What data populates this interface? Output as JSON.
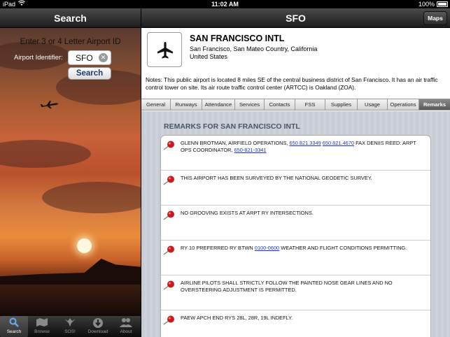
{
  "status": {
    "carrier": "iPad",
    "time": "11:02 AM",
    "battery": "100%"
  },
  "left": {
    "title": "Search",
    "prompt": "Enter 3 or 4 Letter Airport ID",
    "id_label": "Airport Identifier:",
    "id_value": "SFO",
    "search_label": "Search"
  },
  "tabs": [
    {
      "label": "Search",
      "icon": "magnifier-icon",
      "active": true
    },
    {
      "label": "Browse",
      "icon": "map-icon",
      "active": false
    },
    {
      "label": "SOS!",
      "icon": "eagle-icon",
      "active": false
    },
    {
      "label": "Download",
      "icon": "download-icon",
      "active": false
    },
    {
      "label": "About",
      "icon": "people-icon",
      "active": false
    }
  ],
  "right": {
    "title": "SFO",
    "maps_label": "Maps",
    "airport_name": "SAN FRANCISCO INTL",
    "location": "San Francisco, San Mateo Country, California",
    "country": "United States",
    "notes": "Notes: This  public airport is located 8 miles SE of the central business district of San Francisco. It has an air traffic control tower on site. Its air route traffic control center (ARTCC) is Oakland (ZOA)."
  },
  "segments": [
    {
      "label": "General",
      "active": false
    },
    {
      "label": "Runways",
      "active": false
    },
    {
      "label": "Attendance",
      "active": false
    },
    {
      "label": "Services",
      "active": false
    },
    {
      "label": "Contacts",
      "active": false
    },
    {
      "label": "FSS",
      "active": false
    },
    {
      "label": "Supplies",
      "active": false
    },
    {
      "label": "Usage",
      "active": false
    },
    {
      "label": "Operations",
      "active": false
    },
    {
      "label": "Remarks",
      "active": true
    }
  ],
  "remarks_title": "REMARKS FOR SAN FRANCISCO INTL",
  "remarks": [
    {
      "parts": [
        {
          "t": "GLENN BROTMAN, AIRFIELD OPERATIONS, "
        },
        {
          "t": "650.821.3349",
          "link": true
        },
        {
          "t": "  "
        },
        {
          "t": "650.821.4670",
          "link": true
        },
        {
          "t": " FAX   DENIIS REED: ARPT OPS COORDINATOR, "
        },
        {
          "t": "650-821-3341",
          "link": true
        }
      ]
    },
    {
      "parts": [
        {
          "t": "THIS AIRPORT HAS BEEN SURVEYED BY THE NATIONAL GEODETIC SURVEY."
        }
      ]
    },
    {
      "parts": [
        {
          "t": "NO GROOVING EXISTS AT ARPT RY INTERSECTIONS."
        }
      ]
    },
    {
      "parts": [
        {
          "t": "RY 10 PREFERRED RY BTWN "
        },
        {
          "t": "0100-0600",
          "link": true
        },
        {
          "t": " WEATHER AND FLIGHT CONDITIONS PERMITTING."
        }
      ]
    },
    {
      "parts": [
        {
          "t": "AIRLINE PILOTS SHALL STRICTLY FOLLOW THE PAINTED NOSE GEAR LINES AND NO OVERSTEERING ADJUSTMENT IS PERMITTED."
        }
      ]
    },
    {
      "parts": [
        {
          "t": "PAEW APCH END RYS 28L, 28R, 19L INDEFLY."
        }
      ]
    }
  ],
  "colors": {
    "link": "#1a35c8",
    "remarks_title": "#4a5568",
    "pin": "#cc1a1a",
    "active_tab_icon": "#6aaaf0"
  }
}
